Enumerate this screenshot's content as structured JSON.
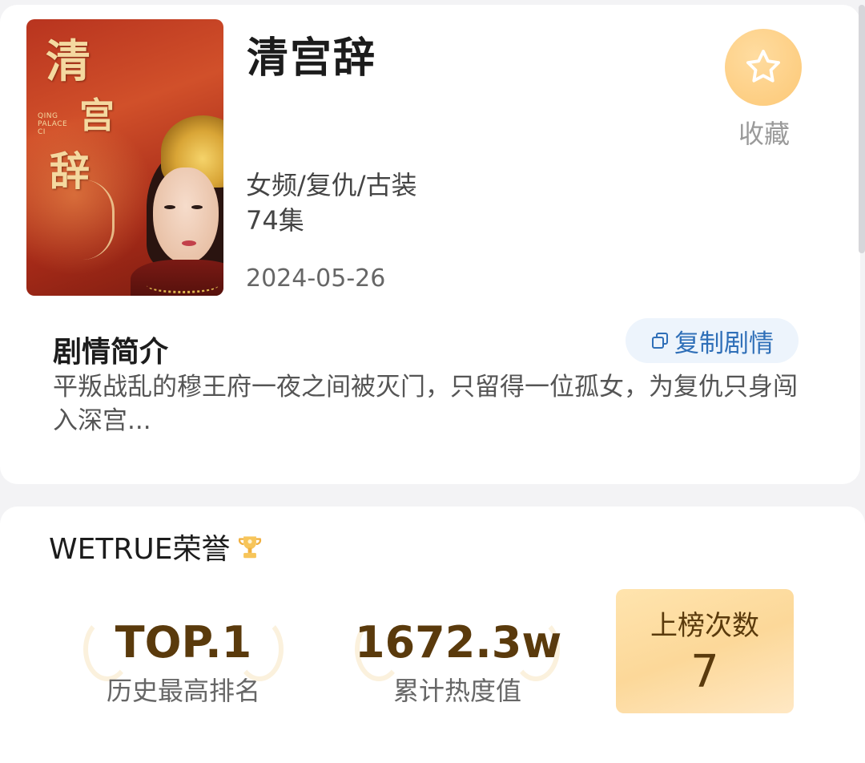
{
  "drama": {
    "title": "清宫辞",
    "genre": "女频/复仇/古装",
    "episodes": "74集",
    "date": "2024-05-26",
    "poster": {
      "title_chars": [
        "清",
        "宫",
        "辞"
      ],
      "roman": "QING PALACE CI"
    }
  },
  "favorite": {
    "label": "收藏",
    "icon": "star-icon",
    "color": "#fcc876"
  },
  "synopsis": {
    "title": "剧情简介",
    "copy_label": "复制剧情",
    "copy_icon": "copy-icon",
    "text": "平叛战乱的穆王府一夜之间被灭门，只留得一位孤女，为复仇只身闯入深宫..."
  },
  "honor": {
    "title": "WETRUE荣誉",
    "badge_icon": "trophy-icon",
    "stats": [
      {
        "value": "TOP.1",
        "label": "历史最高排名"
      },
      {
        "value": "1672.3w",
        "label": "累计热度值"
      },
      {
        "value": "7",
        "label": "上榜次数"
      }
    ]
  },
  "colors": {
    "accent_gold": "#5a3a0c",
    "link_blue": "#2f6fb8"
  }
}
